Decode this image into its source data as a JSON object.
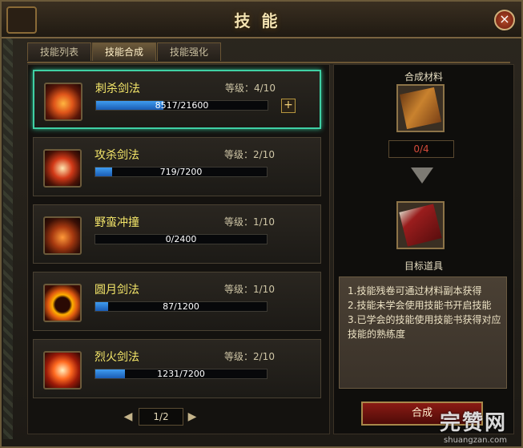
{
  "window": {
    "title": "技能",
    "close_label": "×"
  },
  "tabs": [
    {
      "label": "技能列表",
      "active": false
    },
    {
      "label": "技能合成",
      "active": true
    },
    {
      "label": "技能强化",
      "active": false
    }
  ],
  "skills": [
    {
      "name": "刺杀剑法",
      "level": "等级：4/10",
      "progress_text": "8517/21600",
      "progress": 0.394,
      "selected": true,
      "upgrade": "+"
    },
    {
      "name": "攻杀剑法",
      "level": "等级：2/10",
      "progress_text": "719/7200",
      "progress": 0.1,
      "selected": false
    },
    {
      "name": "野蛮冲撞",
      "level": "等级：1/10",
      "progress_text": "0/2400",
      "progress": 0.0,
      "selected": false
    },
    {
      "name": "圆月剑法",
      "level": "等级：1/10",
      "progress_text": "87/1200",
      "progress": 0.073,
      "selected": false
    },
    {
      "name": "烈火剑法",
      "level": "等级：2/10",
      "progress_text": "1231/7200",
      "progress": 0.171,
      "selected": false
    }
  ],
  "pager": {
    "text": "1/2",
    "prev": "◀",
    "next": "▶"
  },
  "synthesis": {
    "materials_label": "合成材料",
    "material_count": "0/4",
    "target_label": "目标道具",
    "count_color": "#d34a3a",
    "tips": [
      "1.技能残卷可通过材料副本获得",
      "2.技能未学会使用技能书开启技能",
      "3.已学会的技能使用技能书获得对应",
      "技能的熟练度"
    ],
    "button_label": "合成"
  },
  "watermark": {
    "brand": "完赞网",
    "url": "shuangzan.com"
  },
  "colors": {
    "accent_selected": "#3fd0a4",
    "skill_name": "#f5e76a",
    "bar_fill": "#3f9cf0"
  }
}
